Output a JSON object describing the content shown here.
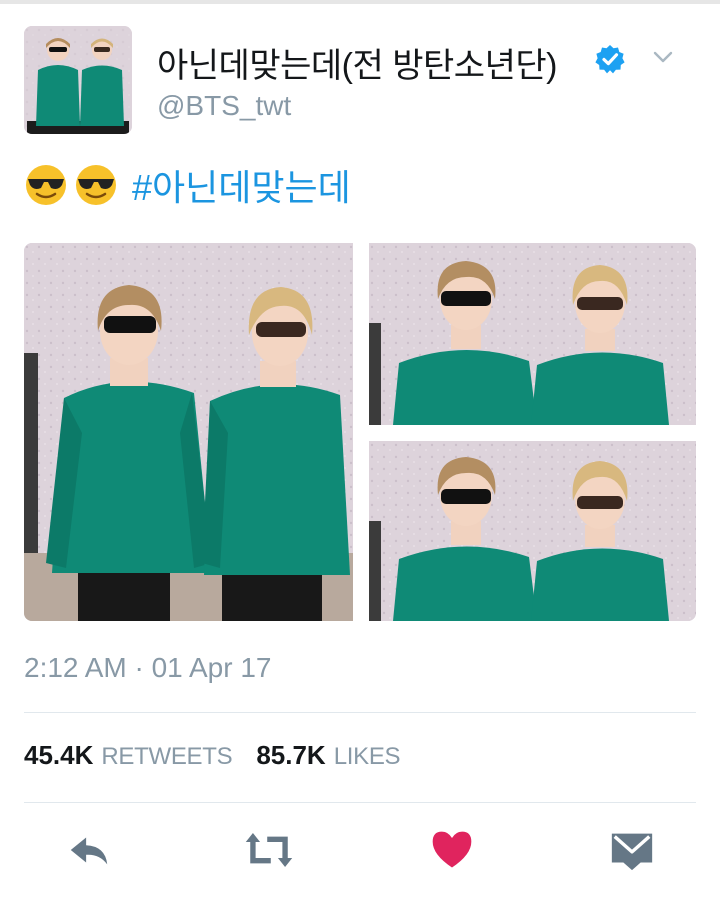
{
  "tweet": {
    "display_name": "아닌데맞는데(전 방탄소년단)",
    "handle": "@BTS_twt",
    "verified": true,
    "text_emojis": [
      "smiling-face-with-sunglasses",
      "smiling-face-with-sunglasses"
    ],
    "hashtag": "#아닌데맞는데",
    "photo_count": 3,
    "timestamp": "2:12 AM · 01 Apr 17",
    "stats": {
      "retweets_count": "45.4K",
      "retweets_label": "RETWEETS",
      "likes_count": "85.7K",
      "likes_label": "LIKES"
    }
  },
  "actions": {
    "icons": [
      "reply-icon",
      "retweet-icon",
      "like-icon",
      "message-icon"
    ],
    "like_active": true
  },
  "colors": {
    "link_blue": "#1b95e0",
    "verified_blue": "#1da1f2",
    "secondary_gray": "#8899a6",
    "like_red": "#e0245e",
    "action_gray": "#657786",
    "sweater_teal": "#0f8a76"
  }
}
